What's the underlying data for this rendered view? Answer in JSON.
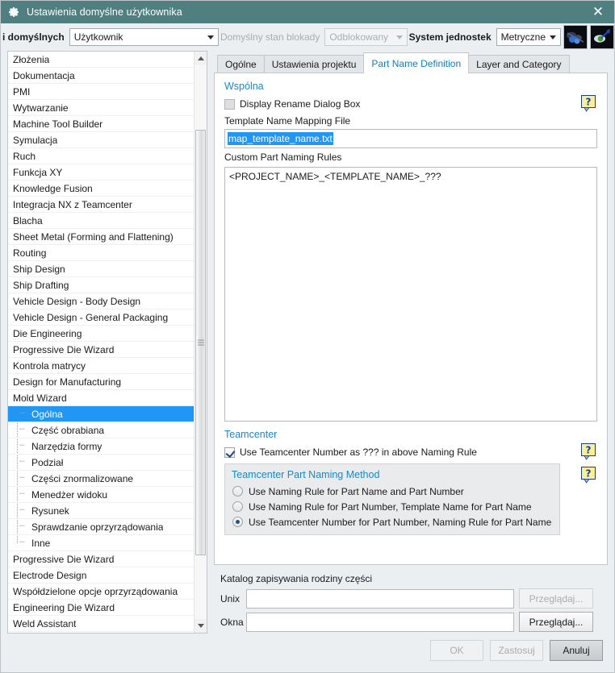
{
  "window": {
    "title": "Ustawienia domyślne użytkownika",
    "gear_icon": "gear-icon",
    "close_icon": "close-icon",
    "titlebar_color": "#4f7f80"
  },
  "toolbar": {
    "scope_label": "i domyślnych",
    "scope_value": "Użytkownik",
    "lock_label": "Domyślny stan blokady",
    "lock_value": "Odblokowany",
    "units_label": "System jednostek",
    "units_value": "Metryczne",
    "icon1": "find-default-icon",
    "icon2": "default-arrow-icon"
  },
  "tree": {
    "items": [
      {
        "label": "Złożenia",
        "level": 0
      },
      {
        "label": "Dokumentacja",
        "level": 0
      },
      {
        "label": "PMI",
        "level": 0
      },
      {
        "label": "Wytwarzanie",
        "level": 0
      },
      {
        "label": "Machine Tool Builder",
        "level": 0
      },
      {
        "label": "Symulacja",
        "level": 0
      },
      {
        "label": "Ruch",
        "level": 0
      },
      {
        "label": "Funkcja XY",
        "level": 0
      },
      {
        "label": "Knowledge Fusion",
        "level": 0
      },
      {
        "label": "Integracja NX z Teamcenter",
        "level": 0
      },
      {
        "label": "Blacha",
        "level": 0
      },
      {
        "label": "Sheet Metal (Forming and Flattening)",
        "level": 0
      },
      {
        "label": "Routing",
        "level": 0
      },
      {
        "label": "Ship Design",
        "level": 0
      },
      {
        "label": "Ship Drafting",
        "level": 0
      },
      {
        "label": "Vehicle Design - Body Design",
        "level": 0
      },
      {
        "label": "Vehicle Design - General Packaging",
        "level": 0
      },
      {
        "label": "Die Engineering",
        "level": 0
      },
      {
        "label": "Progressive Die Wizard",
        "level": 0
      },
      {
        "label": "Kontrola matrycy",
        "level": 0
      },
      {
        "label": "Design for Manufacturing",
        "level": 0
      },
      {
        "label": "Mold Wizard",
        "level": 0
      },
      {
        "label": "Ogólna",
        "level": 1,
        "selected": true
      },
      {
        "label": "Część obrabiana",
        "level": 1
      },
      {
        "label": "Narzędzia formy",
        "level": 1
      },
      {
        "label": "Podział",
        "level": 1
      },
      {
        "label": "Części znormalizowane",
        "level": 1
      },
      {
        "label": "Menedżer widoku",
        "level": 1
      },
      {
        "label": "Rysunek",
        "level": 1
      },
      {
        "label": "Sprawdzanie oprzyrządowania",
        "level": 1
      },
      {
        "label": "Inne",
        "level": 1
      },
      {
        "label": "Progressive Die Wizard",
        "level": 0
      },
      {
        "label": "Electrode Design",
        "level": 0
      },
      {
        "label": "Współdzielone opcje oprzyrządowania",
        "level": 0
      },
      {
        "label": "Engineering Die Wizard",
        "level": 0
      },
      {
        "label": "Weld Assistant",
        "level": 0
      }
    ],
    "scroll_up_icon": "scroll-up-arrow-icon",
    "scroll_down_icon": "scroll-down-arrow-icon"
  },
  "tabs": [
    {
      "label": "Ogólne",
      "active": false
    },
    {
      "label": "Ustawienia projektu",
      "active": false
    },
    {
      "label": "Part Name Definition",
      "active": true
    },
    {
      "label": "Layer and Category",
      "active": false
    }
  ],
  "panel": {
    "common": {
      "title": "Wspólna",
      "display_rename_label": "Display Rename Dialog Box",
      "display_rename_checked": false,
      "template_mapping_label": "Template Name Mapping File",
      "template_mapping_value": "map_template_name.txt",
      "custom_rules_label": "Custom Part Naming Rules",
      "custom_rules_value": "<PROJECT_NAME>_<TEMPLATE_NAME>_???"
    },
    "teamcenter": {
      "title": "Teamcenter",
      "use_tc_number_label": "Use Teamcenter Number as ??? in above Naming Rule",
      "use_tc_number_checked": true,
      "method_title": "Teamcenter Part Naming Method",
      "methods": [
        {
          "label": "Use Naming Rule for Part Name and Part Number",
          "selected": false
        },
        {
          "label": "Use Naming Rule for Part Number, Template Name for Part Name",
          "selected": false
        },
        {
          "label": "Use Teamcenter Number for Part Number, Naming Rule for Part Name",
          "selected": true
        }
      ]
    },
    "directory": {
      "title": "Katalog zapisywania rodziny części",
      "unix_label": "Unix",
      "unix_value": "",
      "unix_browse": "Przeglądaj...",
      "windows_label": "Okna",
      "windows_value": "",
      "windows_browse": "Przeglądaj..."
    },
    "help_icon": "help-question-icon"
  },
  "footer": {
    "ok": "OK",
    "apply": "Zastosuj",
    "cancel": "Anuluj"
  },
  "colors": {
    "accent_blue": "#1c86c8",
    "selection_blue": "#2196f3",
    "title_teal": "#4f7f80",
    "help_yellow": "#fbf09a"
  }
}
